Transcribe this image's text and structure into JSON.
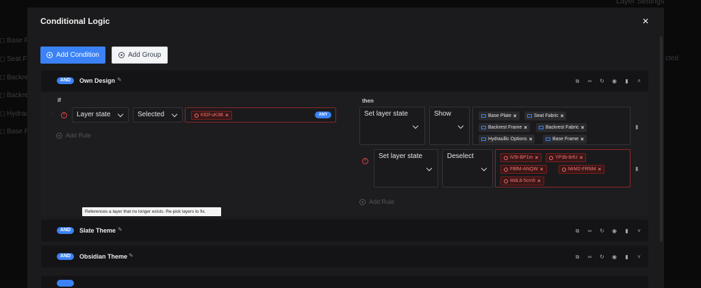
{
  "background": {
    "top_right_text": "Layer Settings",
    "right_text": "cted",
    "items": [
      "Base Pl",
      "Seat Fa",
      "Backres",
      "Backres",
      "Hydrau",
      "Base Fr"
    ]
  },
  "modal": {
    "title": "Conditional Logic",
    "close_icon": "×",
    "add_condition_label": "Add Condition",
    "add_group_label": "Add Group"
  },
  "groups": [
    {
      "operator": "AND",
      "name": "Own Design",
      "expanded": true,
      "if_label": "if",
      "then_label": "then",
      "condition": {
        "field": "Layer state",
        "operator": "Selected",
        "chips": [
          "KlGf-uK3B"
        ],
        "match": "ANY",
        "tooltip": "References a layer that no longer exists. Re-pick layers to fix."
      },
      "add_rule_label": "Add Rule",
      "actions": [
        {
          "action": "Set layer state",
          "value": "Show",
          "chips": [
            "Base Plate",
            "Seat Fabric",
            "Backrest Frame",
            "Backrest Fabric",
            "Hydraullic Options",
            "Base Frame"
          ],
          "error": false
        },
        {
          "action": "Set layer state",
          "value": "Deselect",
          "chips": [
            "iV9I-BP1m",
            "YP3b-8rfU",
            "FBfM-ANQW",
            "MrM2-FRNM",
            "MdL8-5cm5"
          ],
          "error": true
        }
      ],
      "then_add_rule_label": "Add Rule"
    },
    {
      "operator": "AND",
      "name": "Slate Theme",
      "expanded": false
    },
    {
      "operator": "AND",
      "name": "Obsidian Theme",
      "expanded": false
    }
  ],
  "colors": {
    "accent": "#3b82f6",
    "error": "#ef4444",
    "modal_bg": "#1b1b1d"
  },
  "icons": {
    "group_actions": [
      "copy-icon",
      "link-icon",
      "refresh-icon",
      "eye-icon",
      "trash-icon",
      "chevron-icon"
    ]
  }
}
